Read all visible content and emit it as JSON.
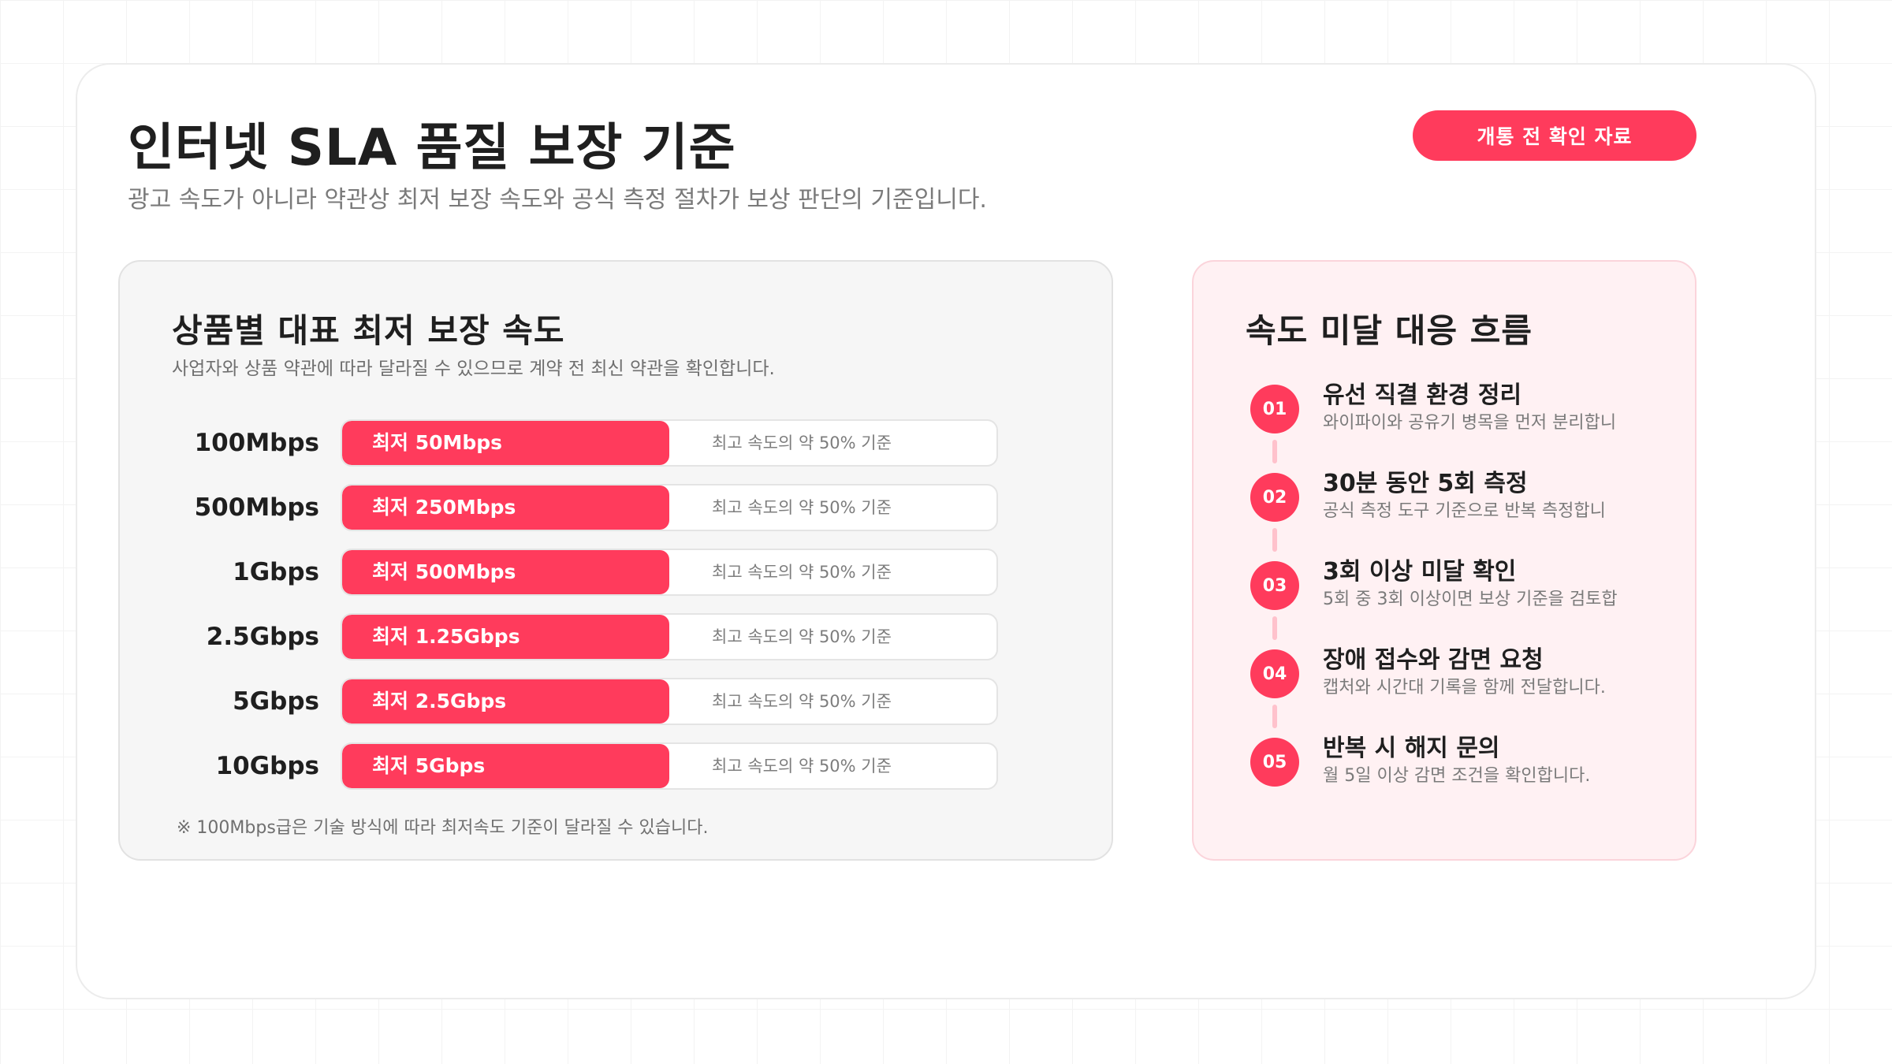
{
  "header": {
    "title": "인터넷 SLA 품질 보장 기준",
    "subtitle": "광고 속도가 아니라 약관상 최저 보장 속도와 공식 측정 절차가 보상 판단의 기준입니다.",
    "badge": "개통 전 확인 자료"
  },
  "colors": {
    "accent": "#ff3b5c",
    "panel_bg": "#f6f6f6",
    "flow_bg": "#fff1f3"
  },
  "speed_panel": {
    "title": "상품별 대표 최저 보장 속도",
    "description": "사업자와 상품 약관에 따라 달라질 수 있으므로 계약 전 최신 약관을 확인합니다.",
    "rows": [
      {
        "plan": "100Mbps",
        "minimum": "최저 50Mbps",
        "note": "최고 속도의 약 50% 기준",
        "ratio": 0.5
      },
      {
        "plan": "500Mbps",
        "minimum": "최저 250Mbps",
        "note": "최고 속도의 약 50% 기준",
        "ratio": 0.5
      },
      {
        "plan": "1Gbps",
        "minimum": "최저 500Mbps",
        "note": "최고 속도의 약 50% 기준",
        "ratio": 0.5
      },
      {
        "plan": "2.5Gbps",
        "minimum": "최저 1.25Gbps",
        "note": "최고 속도의 약 50% 기준",
        "ratio": 0.5
      },
      {
        "plan": "5Gbps",
        "minimum": "최저 2.5Gbps",
        "note": "최고 속도의 약 50% 기준",
        "ratio": 0.5
      },
      {
        "plan": "10Gbps",
        "minimum": "최저 5Gbps",
        "note": "최고 속도의 약 50% 기준",
        "ratio": 0.5
      }
    ],
    "footnote": "※ 100Mbps급은 기술 방식에 따라 최저속도 기준이 달라질 수 있습니다."
  },
  "flow_panel": {
    "title": "속도 미달 대응 흐름",
    "steps": [
      {
        "number": "01",
        "title": "유선 직결 환경 정리",
        "description": "와이파이와 공유기 병목을 먼저 분리합니"
      },
      {
        "number": "02",
        "title": "30분 동안 5회 측정",
        "description": "공식 측정 도구 기준으로 반복 측정합니"
      },
      {
        "number": "03",
        "title": "3회 이상 미달 확인",
        "description": "5회 중 3회 이상이면 보상 기준을 검토합"
      },
      {
        "number": "04",
        "title": "장애 접수와 감면 요청",
        "description": "캡처와 시간대 기록을 함께 전달합니다."
      },
      {
        "number": "05",
        "title": "반복 시 해지 문의",
        "description": "월 5일 이상 감면 조건을 확인합니다."
      }
    ]
  }
}
